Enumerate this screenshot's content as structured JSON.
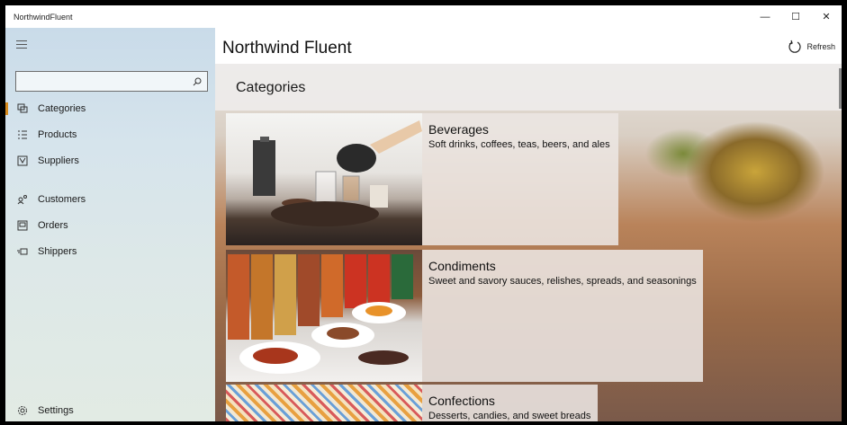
{
  "window": {
    "title": "NorthwindFluent",
    "controls": {
      "minimize": "—",
      "maximize": "☐",
      "close": "✕"
    }
  },
  "sidebar": {
    "search_placeholder": "",
    "items": [
      {
        "label": "Categories",
        "icon": "categories-icon",
        "selected": true
      },
      {
        "label": "Products",
        "icon": "products-icon",
        "selected": false
      },
      {
        "label": "Suppliers",
        "icon": "suppliers-icon",
        "selected": false
      },
      {
        "label": "Customers",
        "icon": "customers-icon",
        "selected": false
      },
      {
        "label": "Orders",
        "icon": "orders-icon",
        "selected": false
      },
      {
        "label": "Shippers",
        "icon": "shippers-icon",
        "selected": false
      }
    ],
    "settings_label": "Settings"
  },
  "header": {
    "app_title": "Northwind Fluent",
    "refresh_label": "Refresh"
  },
  "page": {
    "title": "Categories"
  },
  "categories": [
    {
      "name": "Beverages",
      "description": "Soft drinks, coffees, teas, beers, and ales"
    },
    {
      "name": "Condiments",
      "description": "Sweet and savory sauces, relishes, spreads, and seasonings"
    },
    {
      "name": "Confections",
      "description": "Desserts, candies, and sweet breads"
    }
  ],
  "colors": {
    "accent": "#d78a1c",
    "sidebar_top": "#c9dbe9",
    "sidebar_bottom": "#e2ebe4"
  }
}
